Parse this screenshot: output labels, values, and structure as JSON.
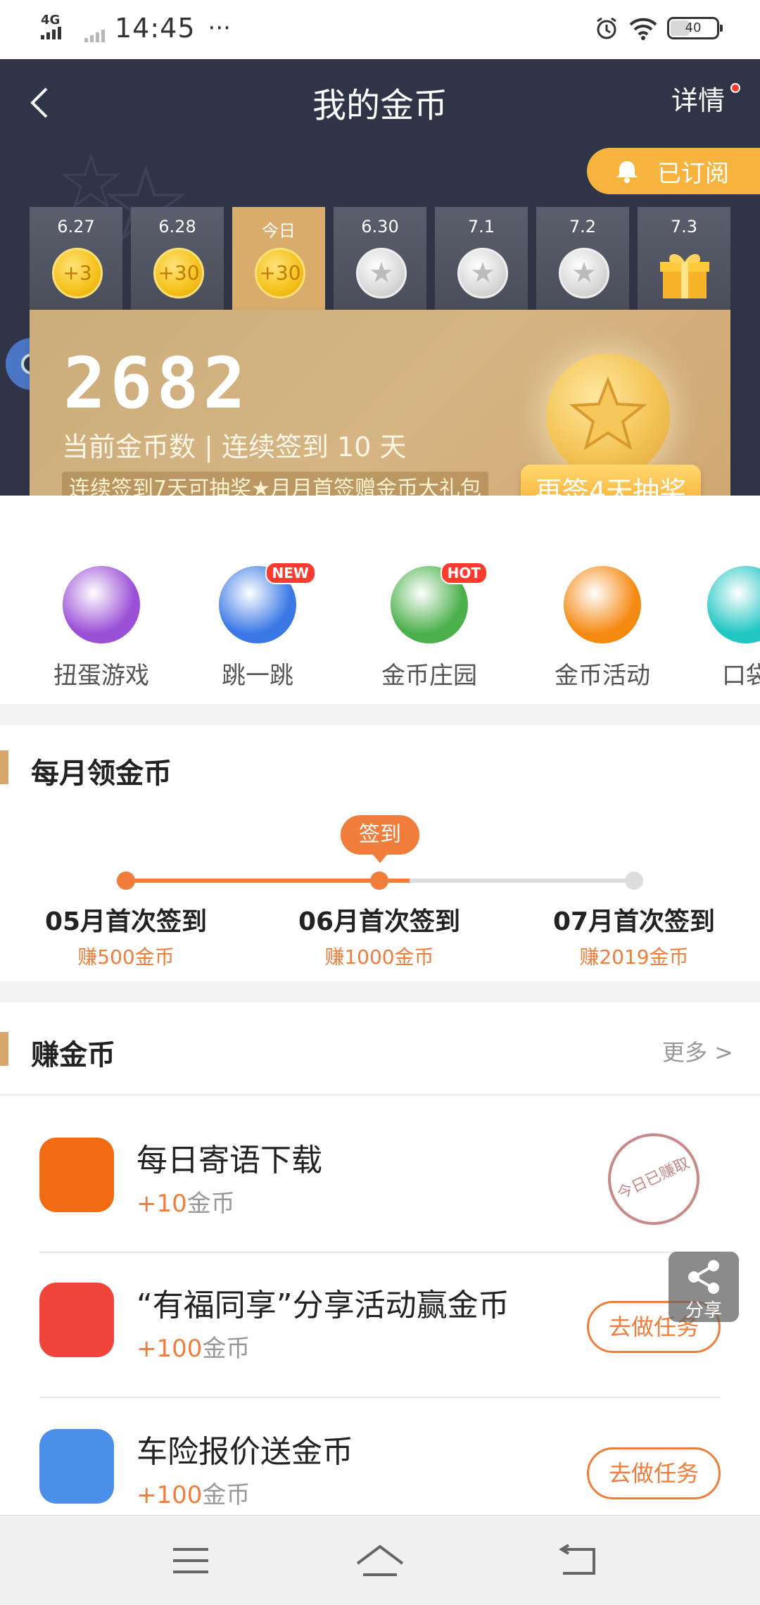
{
  "status_bar": {
    "network": "4G",
    "time": "14:45",
    "more": "···",
    "battery": "40",
    "icons": [
      "signal-icon",
      "alarm-icon",
      "wifi-icon",
      "battery-icon"
    ]
  },
  "header": {
    "title": "我的金币",
    "detail_label": "详情",
    "subscribed_label": "已订阅"
  },
  "checkin_days": [
    {
      "label": "6.27",
      "reward": "+3",
      "state": "claimed"
    },
    {
      "label": "6.28",
      "reward": "+30",
      "state": "claimed"
    },
    {
      "label": "今日",
      "reward": "+30",
      "state": "today"
    },
    {
      "label": "6.30",
      "reward": "",
      "state": "future"
    },
    {
      "label": "7.1",
      "reward": "",
      "state": "future"
    },
    {
      "label": "7.2",
      "reward": "",
      "state": "future"
    },
    {
      "label": "7.3",
      "reward": "",
      "state": "gift"
    }
  ],
  "card": {
    "coin_count": "2682",
    "subtitle": "当前金币数 | 连续签到 10 天",
    "banner": "连续签到7天可抽奖★月月首签赠金币大礼包",
    "draw_button": "再签4天抽奖"
  },
  "features": [
    {
      "label": "扭蛋游戏",
      "badge": "",
      "color": "#9b4fd6"
    },
    {
      "label": "跳一跳",
      "badge": "NEW",
      "color": "#3a78e6"
    },
    {
      "label": "金币庄园",
      "badge": "HOT",
      "color": "#4bb04b"
    },
    {
      "label": "金币活动",
      "badge": "",
      "color": "#f58a12"
    },
    {
      "label": "口袋",
      "badge": "",
      "color": "#21c6c2"
    }
  ],
  "monthly": {
    "title": "每月领金币",
    "sign_label": "签到",
    "progress": 0.56,
    "milestones": [
      {
        "title": "05月首次签到",
        "reward": "赚500金币"
      },
      {
        "title": "06月首次签到",
        "reward": "赚1000金币"
      },
      {
        "title": "07月首次签到",
        "reward": "赚2019金币"
      }
    ]
  },
  "earn": {
    "title": "赚金币",
    "more_label": "更多 >",
    "stamp_label": "今日已赚取",
    "share_label": "分享",
    "tasks": [
      {
        "title": "每日寄语下载",
        "plus": "+10",
        "unit": "金币",
        "button": "",
        "icon_color": "#f26a12"
      },
      {
        "title": "“有福同享”分享活动赢金币",
        "plus": "+100",
        "unit": "金币",
        "button": "去做任务",
        "icon_color": "#f0453a"
      },
      {
        "title": "车险报价送金币",
        "plus": "+100",
        "unit": "金币",
        "button": "去做任务",
        "icon_color": "#4a8fe8"
      }
    ]
  },
  "colors": {
    "accent": "#f07d3a",
    "hero_bg": "#2f3447",
    "gold": "#d6b584"
  }
}
